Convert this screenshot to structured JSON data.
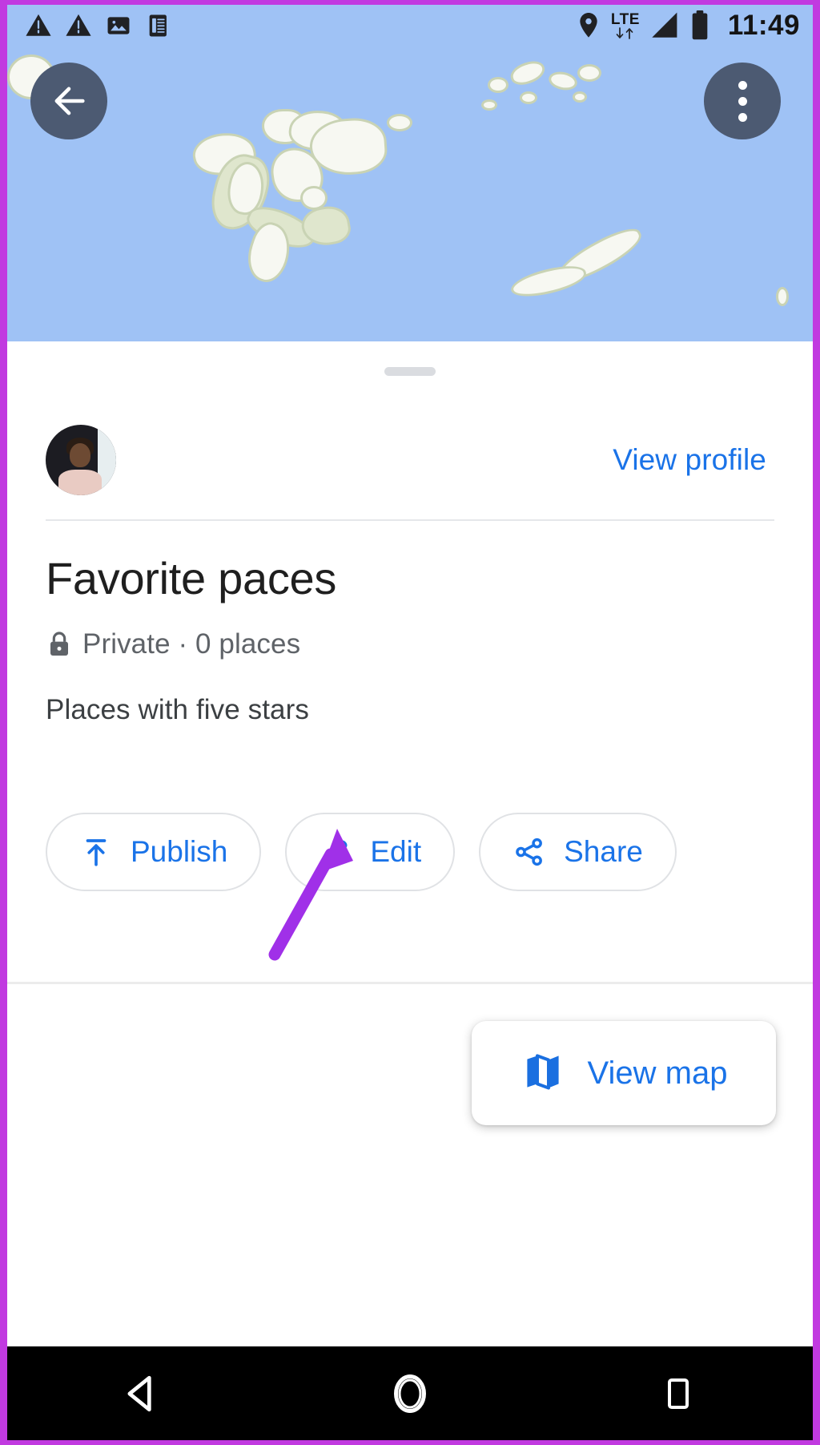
{
  "status_bar": {
    "icons": [
      "warning-triangle-icon",
      "warning-triangle-icon",
      "image-icon",
      "document-icon"
    ],
    "location_icon": "location-pin-icon",
    "network_label": "LTE",
    "signal_icon": "signal-bars-icon",
    "battery_icon": "battery-icon",
    "time": "11:49"
  },
  "map": {
    "back_icon": "back-arrow-icon",
    "overflow_icon": "more-vertical-icon",
    "water_color": "#9fc2f5",
    "land_color": "#f7f8f2",
    "land_edge_color": "#c9d3b4"
  },
  "sheet": {
    "handle": "drag-handle",
    "profile": {
      "avatar": "user-avatar",
      "view_profile_label": "View profile"
    },
    "list": {
      "title": "Favorite paces",
      "privacy_icon": "lock-icon",
      "meta": "Private · 0 places",
      "description": "Places with five stars"
    },
    "actions": [
      {
        "label": "Publish",
        "icon": "upload-icon"
      },
      {
        "label": "Edit",
        "icon": "pencil-icon"
      },
      {
        "label": "Share",
        "icon": "share-icon"
      }
    ],
    "view_map": {
      "label": "View map",
      "icon": "map-icon"
    }
  },
  "annotation": {
    "arrow_color": "#a030e8",
    "points_to": "Edit"
  },
  "nav_bar": {
    "back": "nav-back-triangle",
    "home": "nav-home-circle",
    "recents": "nav-recents-square"
  },
  "colors": {
    "accent_blue": "#1a73e8",
    "text_primary": "#1f1f1f",
    "text_secondary": "#5f6368",
    "border_magenta": "#c13ae0"
  }
}
